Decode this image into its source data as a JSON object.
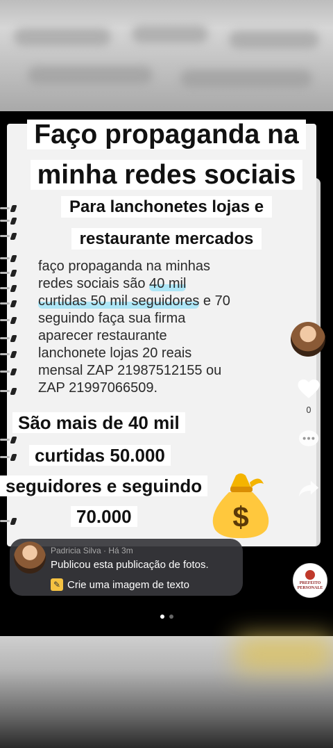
{
  "post": {
    "title_line1": "Faço propaganda na",
    "title_line2": "minha redes sociais",
    "subtitle_line1": "Para lanchonetes lojas e",
    "subtitle_line2": "restaurante mercados",
    "body_line1": "faço propaganda na minhas",
    "body_line2a": "redes sociais são ",
    "body_line2b": "40 mil",
    "body_line3a": "curtidas 50 mil seguidores",
    "body_line3b": " e 70",
    "body_line4": "seguindo faça sua firma",
    "body_line5": "aparecer restaurante",
    "body_line6": "lanchonete lojas 20 reais",
    "body_line7": "mensal ZAP 21987512155 ou",
    "body_line8": "ZAP 21997066509.",
    "big_line1": "São mais de 40 mil",
    "big_line2": "curtidas 50.000",
    "big_line3": "seguidores e seguindo",
    "big_line4": "70.000",
    "money_bag_icon": "money-bag-icon"
  },
  "actions": {
    "like_count": "0",
    "like_icon": "heart-icon",
    "comment_icon": "comment-icon",
    "share_icon": "share-icon"
  },
  "publication": {
    "author_meta": "Padricia Silva · Há 3m",
    "line1": "Publicou esta publicação de fotos.",
    "line2": "Crie uma imagem de texto",
    "pencil_icon": "pencil-icon"
  },
  "badge": {
    "text": "PREFEITO PERSONALE"
  },
  "pager": {
    "count": 2,
    "active": 0
  },
  "colors": {
    "highlight": "#aee6f6",
    "card": "#37373c",
    "accent_yellow": "#f5c242"
  }
}
